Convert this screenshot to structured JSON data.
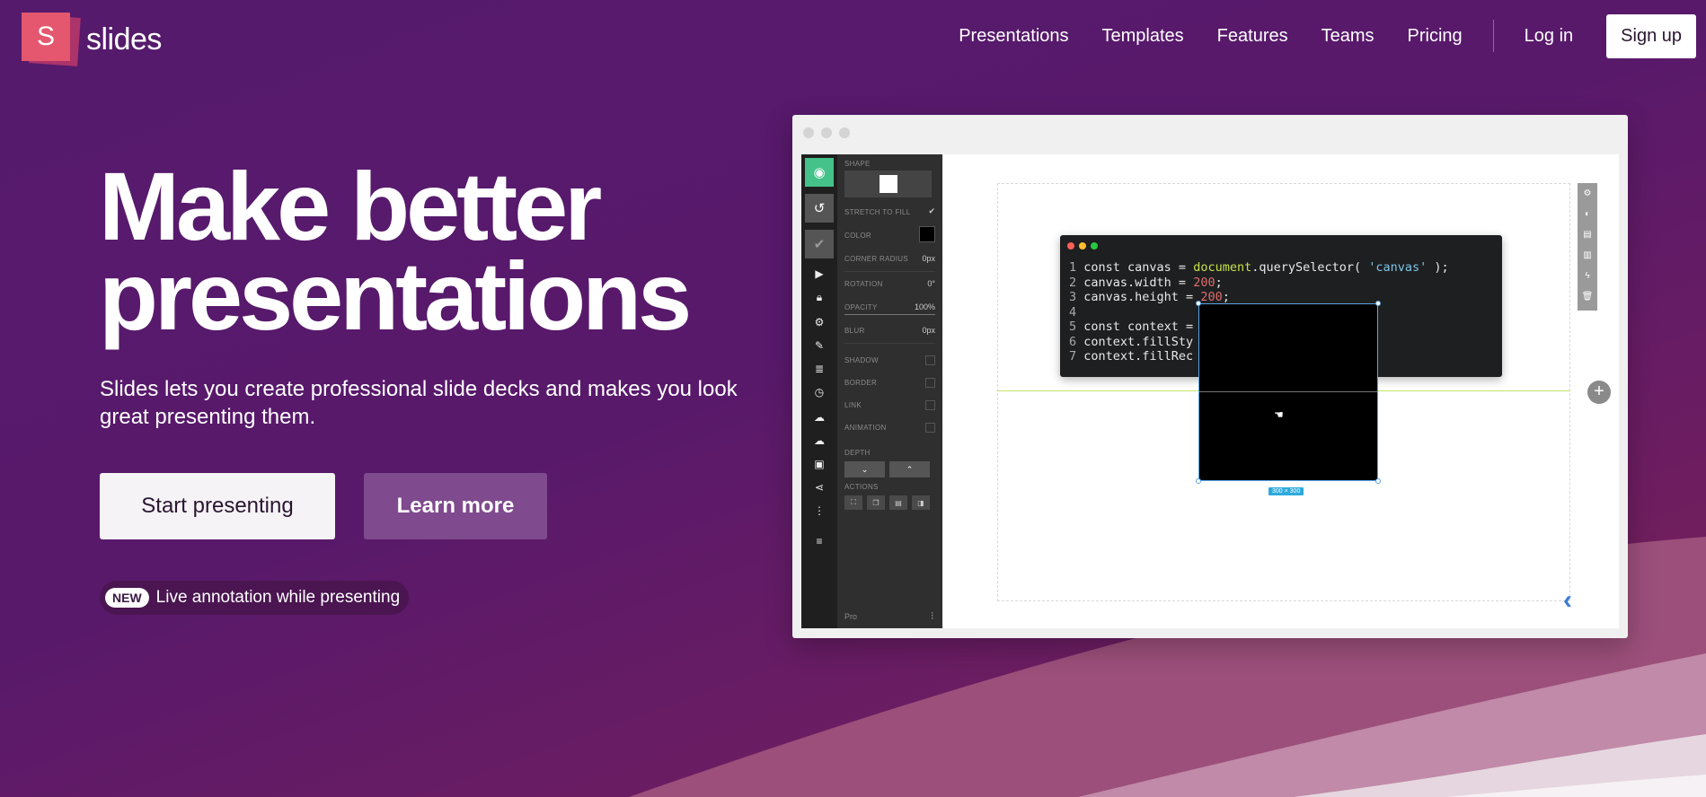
{
  "brand": {
    "logo_letter": "S",
    "name": "slides",
    "primary_color": "#e4576e",
    "bg_color": "#541a6a"
  },
  "nav": {
    "links": [
      "Presentations",
      "Templates",
      "Features",
      "Teams",
      "Pricing"
    ],
    "login": "Log in",
    "signup": "Sign up"
  },
  "hero": {
    "title_line1": "Make better",
    "title_line2": "presentations",
    "subtitle": "Slides lets you create professional slide decks and makes you look great presenting them.",
    "start_button": "Start presenting",
    "learn_button": "Learn more",
    "badge": "NEW",
    "badge_text": "Live annotation while presenting"
  },
  "editor": {
    "panel": {
      "shape": "SHAPE",
      "stretch": "STRETCH TO FILL",
      "color": "COLOR",
      "corner_radius": "CORNER RADIUS",
      "corner_radius_val": "0px",
      "rotation": "ROTATION",
      "rotation_val": "0°",
      "opacity": "OPACITY",
      "opacity_val": "100%",
      "blur": "BLUR",
      "blur_val": "0px",
      "shadow": "SHADOW",
      "border": "BORDER",
      "link": "LINK",
      "animation": "ANIMATION",
      "depth": "DEPTH",
      "actions": "ACTIONS",
      "footer": "Pro"
    },
    "size_tag": "300 × 300",
    "code": {
      "l1_a": "const canvas = ",
      "l1_fn": "document",
      "l1_b": ".querySelector( ",
      "l1_str": "'canvas'",
      "l1_c": " );",
      "l2_a": "canvas.width = ",
      "l2_num": "200",
      "l2_b": ";",
      "l3_a": "canvas.height = ",
      "l3_num": "200",
      "l3_b": ";",
      "l5_a": "const context = ",
      "l5_c": " );",
      "l6_a": "context.fillSty",
      "l7_a": "context.fillRec"
    }
  }
}
